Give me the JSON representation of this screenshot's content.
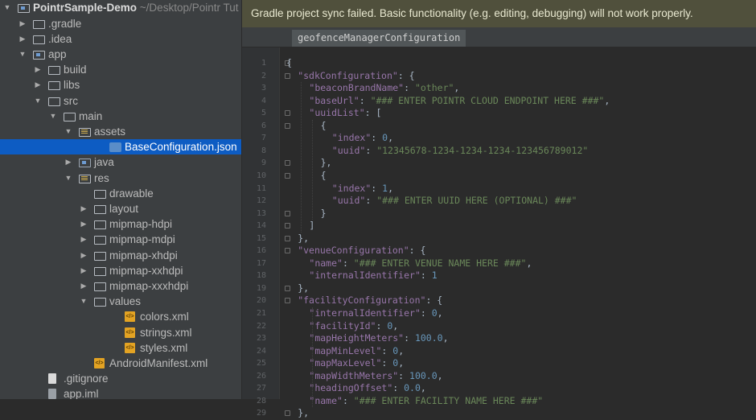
{
  "project_tree": {
    "project_name": "PointrSample-Demo",
    "project_path": "~/Desktop/Pointr Tut",
    "items": [
      {
        "label": ".gradle",
        "arrow": "▶",
        "level": 1,
        "icon": "folder"
      },
      {
        "label": ".idea",
        "arrow": "▶",
        "level": 1,
        "icon": "folder"
      },
      {
        "label": "app",
        "arrow": "▼",
        "level": 1,
        "icon": "module-folder"
      },
      {
        "label": "build",
        "arrow": "▶",
        "level": 2,
        "icon": "folder"
      },
      {
        "label": "libs",
        "arrow": "▶",
        "level": 2,
        "icon": "folder"
      },
      {
        "label": "src",
        "arrow": "▼",
        "level": 2,
        "icon": "folder"
      },
      {
        "label": "main",
        "arrow": "▼",
        "level": 3,
        "icon": "folder"
      },
      {
        "label": "assets",
        "arrow": "▼",
        "level": 4,
        "icon": "resource-folder"
      },
      {
        "label": "BaseConfiguration.json",
        "arrow": "",
        "level": 6,
        "icon": "json-file",
        "selected": true
      },
      {
        "label": "java",
        "arrow": "▶",
        "level": 4,
        "icon": "source-folder"
      },
      {
        "label": "res",
        "arrow": "▼",
        "level": 4,
        "icon": "resource-folder"
      },
      {
        "label": "drawable",
        "arrow": "",
        "level": 5,
        "icon": "folder"
      },
      {
        "label": "layout",
        "arrow": "▶",
        "level": 5,
        "icon": "folder"
      },
      {
        "label": "mipmap-hdpi",
        "arrow": "▶",
        "level": 5,
        "icon": "folder"
      },
      {
        "label": "mipmap-mdpi",
        "arrow": "▶",
        "level": 5,
        "icon": "folder"
      },
      {
        "label": "mipmap-xhdpi",
        "arrow": "▶",
        "level": 5,
        "icon": "folder"
      },
      {
        "label": "mipmap-xxhdpi",
        "arrow": "▶",
        "level": 5,
        "icon": "folder"
      },
      {
        "label": "mipmap-xxxhdpi",
        "arrow": "▶",
        "level": 5,
        "icon": "folder"
      },
      {
        "label": "values",
        "arrow": "▼",
        "level": 5,
        "icon": "folder"
      },
      {
        "label": "colors.xml",
        "arrow": "",
        "level": 7,
        "icon": "xml-file"
      },
      {
        "label": "strings.xml",
        "arrow": "",
        "level": 7,
        "icon": "xml-file"
      },
      {
        "label": "styles.xml",
        "arrow": "",
        "level": 7,
        "icon": "xml-file"
      },
      {
        "label": "AndroidManifest.xml",
        "arrow": "",
        "level": 5,
        "icon": "xml-file"
      },
      {
        "label": ".gitignore",
        "arrow": "",
        "level": 2,
        "icon": "file"
      },
      {
        "label": "app.iml",
        "arrow": "",
        "level": 2,
        "icon": "file"
      }
    ]
  },
  "notification": {
    "text": "Gradle project sync failed. Basic functionality (e.g. editing, debugging) will not work properly."
  },
  "editor": {
    "tab_title": "geofenceManagerConfiguration",
    "lines": [
      {
        "num": "1",
        "indent": 0,
        "tokens": [
          {
            "t": "p",
            "v": "{"
          }
        ]
      },
      {
        "num": "2",
        "indent": 1,
        "tokens": [
          {
            "t": "k",
            "v": "\"sdkConfiguration\""
          },
          {
            "t": "p",
            "v": ": {"
          }
        ]
      },
      {
        "num": "3",
        "indent": 2,
        "tokens": [
          {
            "t": "k",
            "v": "\"beaconBrandName\""
          },
          {
            "t": "p",
            "v": ": "
          },
          {
            "t": "s",
            "v": "\"other\""
          },
          {
            "t": "p",
            "v": ","
          }
        ]
      },
      {
        "num": "4",
        "indent": 2,
        "tokens": [
          {
            "t": "k",
            "v": "\"baseUrl\""
          },
          {
            "t": "p",
            "v": ": "
          },
          {
            "t": "s",
            "v": "\"### ENTER POINTR CLOUD ENDPOINT HERE ###\""
          },
          {
            "t": "p",
            "v": ","
          }
        ]
      },
      {
        "num": "5",
        "indent": 2,
        "tokens": [
          {
            "t": "k",
            "v": "\"uuidList\""
          },
          {
            "t": "p",
            "v": ": ["
          }
        ]
      },
      {
        "num": "6",
        "indent": 3,
        "tokens": [
          {
            "t": "p",
            "v": "{"
          }
        ]
      },
      {
        "num": "7",
        "indent": 4,
        "tokens": [
          {
            "t": "k",
            "v": "\"index\""
          },
          {
            "t": "p",
            "v": ": "
          },
          {
            "t": "n",
            "v": "0"
          },
          {
            "t": "p",
            "v": ","
          }
        ]
      },
      {
        "num": "8",
        "indent": 4,
        "tokens": [
          {
            "t": "k",
            "v": "\"uuid\""
          },
          {
            "t": "p",
            "v": ": "
          },
          {
            "t": "s",
            "v": "\"12345678-1234-1234-1234-123456789012\""
          }
        ]
      },
      {
        "num": "9",
        "indent": 3,
        "tokens": [
          {
            "t": "p",
            "v": "},"
          }
        ]
      },
      {
        "num": "10",
        "indent": 3,
        "tokens": [
          {
            "t": "p",
            "v": "{"
          }
        ]
      },
      {
        "num": "11",
        "indent": 4,
        "tokens": [
          {
            "t": "k",
            "v": "\"index\""
          },
          {
            "t": "p",
            "v": ": "
          },
          {
            "t": "n",
            "v": "1"
          },
          {
            "t": "p",
            "v": ","
          }
        ]
      },
      {
        "num": "12",
        "indent": 4,
        "tokens": [
          {
            "t": "k",
            "v": "\"uuid\""
          },
          {
            "t": "p",
            "v": ": "
          },
          {
            "t": "s",
            "v": "\"### ENTER UUID HERE (OPTIONAL) ###\""
          }
        ]
      },
      {
        "num": "13",
        "indent": 3,
        "tokens": [
          {
            "t": "p",
            "v": "}"
          }
        ]
      },
      {
        "num": "14",
        "indent": 2,
        "tokens": [
          {
            "t": "p",
            "v": "]"
          }
        ]
      },
      {
        "num": "15",
        "indent": 1,
        "tokens": [
          {
            "t": "p",
            "v": "},"
          }
        ]
      },
      {
        "num": "16",
        "indent": 1,
        "tokens": [
          {
            "t": "k",
            "v": "\"venueConfiguration\""
          },
          {
            "t": "p",
            "v": ": {"
          }
        ]
      },
      {
        "num": "17",
        "indent": 2,
        "tokens": [
          {
            "t": "k",
            "v": "\"name\""
          },
          {
            "t": "p",
            "v": ": "
          },
          {
            "t": "s",
            "v": "\"### ENTER VENUE NAME HERE ###\""
          },
          {
            "t": "p",
            "v": ","
          }
        ]
      },
      {
        "num": "18",
        "indent": 2,
        "tokens": [
          {
            "t": "k",
            "v": "\"internalIdentifier\""
          },
          {
            "t": "p",
            "v": ": "
          },
          {
            "t": "n",
            "v": "1"
          }
        ]
      },
      {
        "num": "19",
        "indent": 1,
        "tokens": [
          {
            "t": "p",
            "v": "},"
          }
        ]
      },
      {
        "num": "20",
        "indent": 1,
        "tokens": [
          {
            "t": "k",
            "v": "\"facilityConfiguration\""
          },
          {
            "t": "p",
            "v": ": {"
          }
        ]
      },
      {
        "num": "21",
        "indent": 2,
        "tokens": [
          {
            "t": "k",
            "v": "\"internalIdentifier\""
          },
          {
            "t": "p",
            "v": ": "
          },
          {
            "t": "n",
            "v": "0"
          },
          {
            "t": "p",
            "v": ","
          }
        ]
      },
      {
        "num": "22",
        "indent": 2,
        "tokens": [
          {
            "t": "k",
            "v": "\"facilityId\""
          },
          {
            "t": "p",
            "v": ": "
          },
          {
            "t": "n",
            "v": "0"
          },
          {
            "t": "p",
            "v": ","
          }
        ]
      },
      {
        "num": "23",
        "indent": 2,
        "tokens": [
          {
            "t": "k",
            "v": "\"mapHeightMeters\""
          },
          {
            "t": "p",
            "v": ": "
          },
          {
            "t": "n",
            "v": "100.0"
          },
          {
            "t": "p",
            "v": ","
          }
        ]
      },
      {
        "num": "24",
        "indent": 2,
        "tokens": [
          {
            "t": "k",
            "v": "\"mapMinLevel\""
          },
          {
            "t": "p",
            "v": ": "
          },
          {
            "t": "n",
            "v": "0"
          },
          {
            "t": "p",
            "v": ","
          }
        ]
      },
      {
        "num": "25",
        "indent": 2,
        "tokens": [
          {
            "t": "k",
            "v": "\"mapMaxLevel\""
          },
          {
            "t": "p",
            "v": ": "
          },
          {
            "t": "n",
            "v": "0"
          },
          {
            "t": "p",
            "v": ","
          }
        ]
      },
      {
        "num": "26",
        "indent": 2,
        "tokens": [
          {
            "t": "k",
            "v": "\"mapWidthMeters\""
          },
          {
            "t": "p",
            "v": ": "
          },
          {
            "t": "n",
            "v": "100.0"
          },
          {
            "t": "p",
            "v": ","
          }
        ]
      },
      {
        "num": "27",
        "indent": 2,
        "tokens": [
          {
            "t": "k",
            "v": "\"headingOffset\""
          },
          {
            "t": "p",
            "v": ": "
          },
          {
            "t": "n",
            "v": "0.0"
          },
          {
            "t": "p",
            "v": ","
          }
        ]
      },
      {
        "num": "28",
        "indent": 2,
        "tokens": [
          {
            "t": "k",
            "v": "\"name\""
          },
          {
            "t": "p",
            "v": ": "
          },
          {
            "t": "s",
            "v": "\"### ENTER FACILITY NAME HERE ###\""
          }
        ]
      },
      {
        "num": "29",
        "indent": 1,
        "tokens": [
          {
            "t": "p",
            "v": "},"
          }
        ]
      }
    ]
  },
  "colors": {
    "sidebar_bg": "#3c3f41",
    "editor_bg": "#2b2b2b",
    "selection": "#0d5cc3",
    "banner_bg": "#50503c",
    "json_key": "#9876aa",
    "json_string": "#6a8759",
    "json_number": "#6897bb"
  }
}
